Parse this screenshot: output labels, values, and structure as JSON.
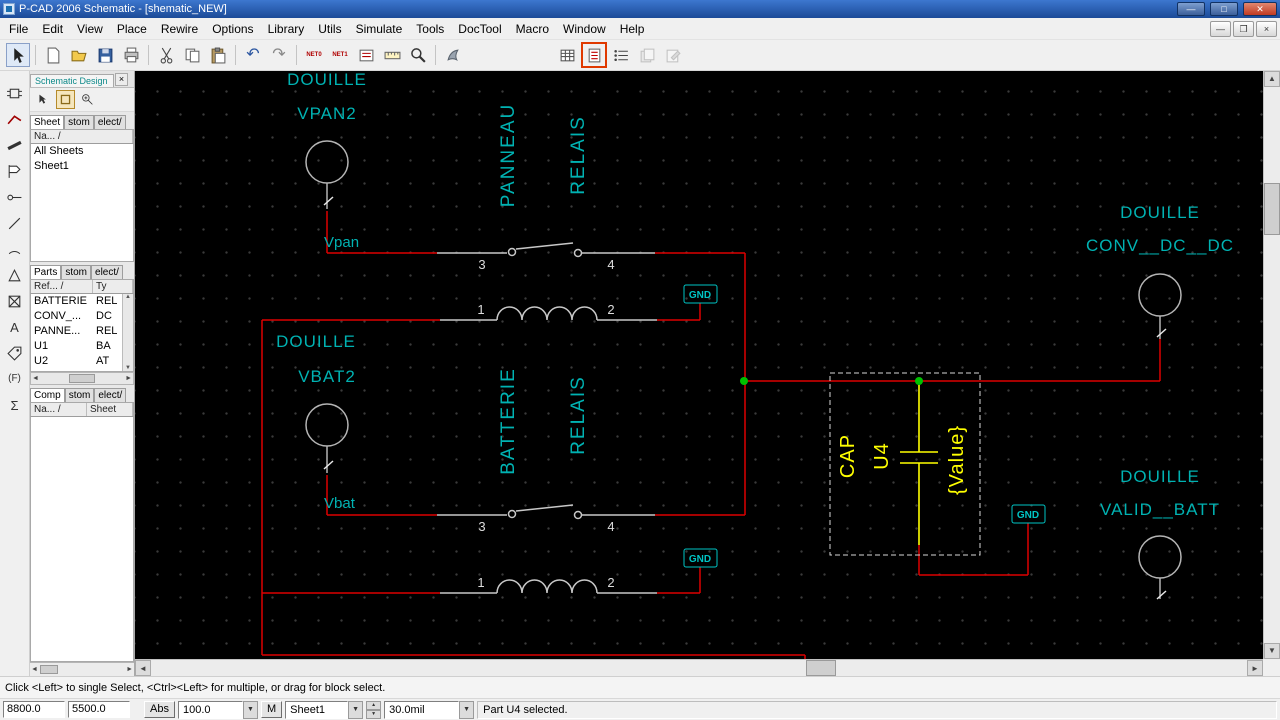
{
  "window": {
    "title": "P-CAD 2006 Schematic - [shematic_NEW]"
  },
  "menu": {
    "items": [
      "File",
      "Edit",
      "View",
      "Place",
      "Rewire",
      "Options",
      "Library",
      "Utils",
      "Simulate",
      "Tools",
      "DocTool",
      "Macro",
      "Window",
      "Help"
    ]
  },
  "toolbar": {
    "net0": "NET0",
    "net1": "NET1"
  },
  "left_toolbar": {
    "text_tool": "A",
    "field_tool": "(F)",
    "macro_tool": "Σ"
  },
  "left_panel": {
    "tab_title": "Schematic Design",
    "sheet_tab": "Sheet",
    "parts_tab": "Parts",
    "comp_tab": "Comp",
    "tab2": "stom",
    "tab3": "elect/",
    "sheet_header": "Na...  /",
    "sheet_rows": [
      "All Sheets",
      "Sheet1"
    ],
    "parts_header_ref": "Ref...  /",
    "parts_header_type": "Ty",
    "parts_rows": [
      [
        "BATTERIE",
        "REL"
      ],
      [
        "CONV_...",
        "DC"
      ],
      [
        "PANNE...",
        "REL"
      ],
      [
        "U1",
        "BA"
      ],
      [
        "U2",
        "AT"
      ]
    ],
    "comp_header_name": "Na...  /",
    "comp_header_sheet": "Sheet"
  },
  "schematic": {
    "vpan2_1": "DOUILLE",
    "vpan2_2": "VPAN2",
    "panneau": "PANNEAU",
    "relais": "RELAIS",
    "vpan": "Vpan",
    "vbat2_1": "DOUILLE",
    "vbat2_2": "VBAT2",
    "batterie": "BATTERIE",
    "vbat": "Vbat",
    "conv_1": "DOUILLE",
    "conv_2": "CONV__DC__DC",
    "valid_1": "DOUILLE",
    "valid_2": "VALID__BATT",
    "cap_name": "CAP",
    "cap_ref": "U4",
    "cap_value": "{Value}",
    "gnd": "GND",
    "pin1": "1",
    "pin2": "2",
    "pin3": "3",
    "pin4": "4"
  },
  "status": {
    "message": "Click <Left> to single Select, <Ctrl><Left> for multiple, or drag for block select.",
    "x": "8800.0",
    "y": "5500.0",
    "abs": "Abs",
    "zoom": "100.0",
    "mode": "M",
    "sheet": "Sheet1",
    "grid": "30.0mil",
    "info": "Part U4 selected."
  },
  "colors": {
    "wire": "#dd0000",
    "label": "#00b2b2",
    "selected": "#ffff00",
    "junction": "#00c000"
  }
}
